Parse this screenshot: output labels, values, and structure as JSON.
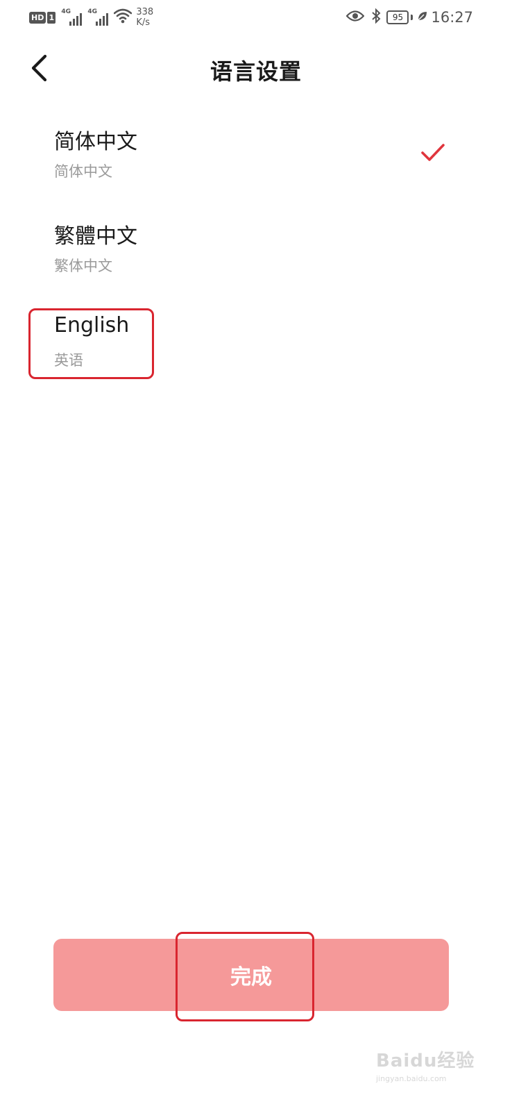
{
  "status_bar": {
    "hd_label": "HD",
    "sim_label": "1",
    "network_1": "4G",
    "network_2": "4G",
    "speed_value": "338",
    "speed_unit": "K/s",
    "battery": "95",
    "time": "16:27",
    "icons": [
      "eye-icon",
      "bluetooth-icon",
      "battery-icon",
      "leaf-icon",
      "wifi-icon",
      "signal-icon"
    ]
  },
  "header": {
    "title": "语言设置",
    "back_icon": "chevron-left-icon"
  },
  "languages": [
    {
      "native": "简体中文",
      "zh": "简体中文",
      "selected": true
    },
    {
      "native": "繁體中文",
      "zh": "繁体中文",
      "selected": false
    },
    {
      "native": "English",
      "zh": "英语",
      "selected": false
    }
  ],
  "done_button": {
    "label": "完成"
  },
  "watermark": {
    "text": "Baidu经验",
    "url": "jingyan.baidu.com"
  },
  "colors": {
    "accent": "#e0353d",
    "button_bg": "#f59999",
    "annotation": "#d9252f"
  }
}
